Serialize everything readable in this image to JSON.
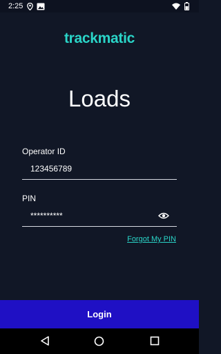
{
  "status_bar": {
    "time": "2:25"
  },
  "app": {
    "brand": "trackmatic",
    "title": "Loads"
  },
  "form": {
    "operator_id": {
      "label": "Operator ID",
      "value": "123456789"
    },
    "pin": {
      "label": "PIN",
      "value": "**********"
    },
    "forgot_pin": "Forgot My PIN"
  },
  "actions": {
    "login": "Login"
  },
  "colors": {
    "accent": "#2ad5c8",
    "background": "#111726",
    "primary_button": "#1f10c4"
  }
}
